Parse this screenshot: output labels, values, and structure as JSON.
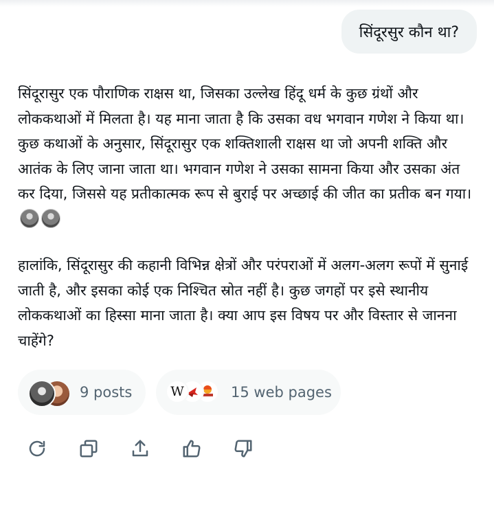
{
  "conversation": {
    "user_message": "सिंदूरसुर कौन था?",
    "answer": {
      "paragraph_1": "सिंदूरासुर एक पौराणिक राक्षस था, जिसका उल्लेख हिंदू धर्म के कुछ ग्रंथों और लोककथाओं में मिलता है। यह माना जाता है कि उसका वध भगवान गणेश ने किया था। कुछ कथाओं के अनुसार, सिंदूरासुर एक शक्तिशाली राक्षस था जो अपनी शक्ति और आतंक के लिए जाना जाता था। भगवान गणेश ने उसका सामना किया और उसका अंत कर दिया, जिससे यह प्रतीकात्मक रूप से बुराई पर अच्छाई की जीत का प्रतीक बन गया।",
      "paragraph_2": "हालांकि, सिंदूरासुर की कहानी विभिन्न क्षेत्रों और परंपराओं में अलग-अलग रूपों में सुनाई जाती है, और इसका कोई एक निश्चित स्रोत नहीं है। कुछ जगहों पर इसे स्थानीय लोककथाओं का हिस्सा माना जाता है। क्या आप इस विषय पर और विस्तार से जानना चाहेंगे?"
    }
  },
  "sources": {
    "posts_label": "9 posts",
    "web_pages_label": "15 web pages",
    "wikipedia_glyph": "W"
  },
  "actions": {
    "icons": [
      "refresh-icon",
      "copy-icon",
      "share-icon",
      "thumbs-up-icon",
      "thumbs-down-icon"
    ]
  },
  "colors": {
    "bubble_bg": "#eff3f4",
    "chip_bg": "#f7f9f9",
    "text": "#0f1419",
    "muted": "#536471"
  }
}
